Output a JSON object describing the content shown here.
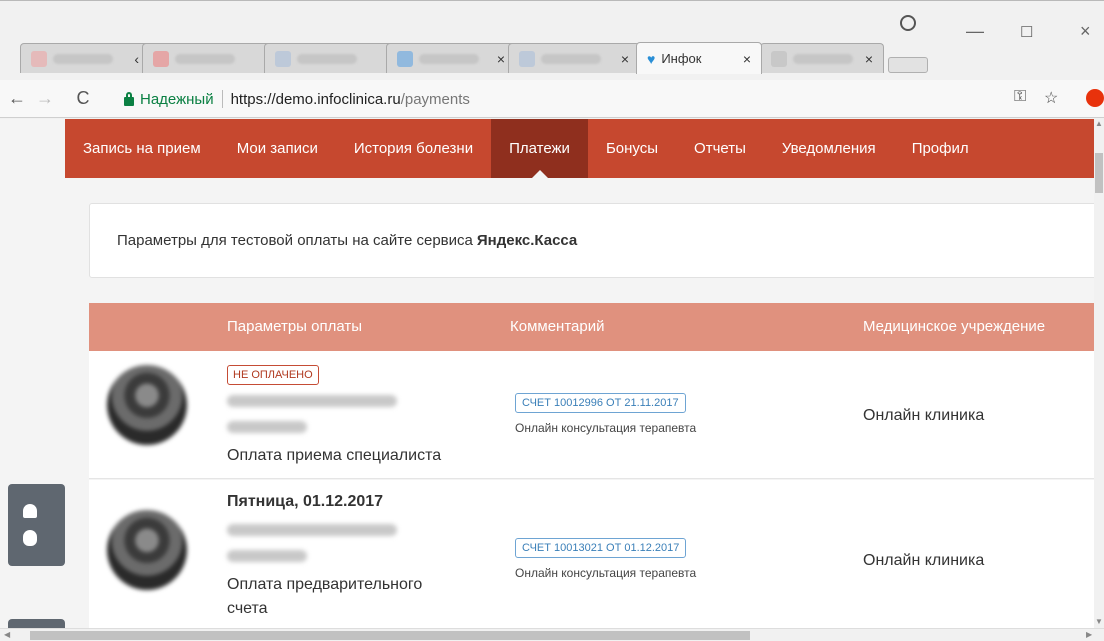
{
  "browser": {
    "tabs": [
      {
        "title": "",
        "close": "‹"
      },
      {
        "title": "",
        "close": ""
      },
      {
        "title": "",
        "close": ""
      },
      {
        "title": "",
        "close": "×"
      },
      {
        "title": "",
        "close": "×"
      },
      {
        "title": "Инфок",
        "close": "×"
      },
      {
        "title": "",
        "close": "×"
      }
    ],
    "window_controls": {
      "minimize": "—",
      "maximize": "☐",
      "close": "×"
    },
    "secure_label": "Надежный",
    "url_host": "https://demo.infoclinica.ru",
    "url_path": "/payments"
  },
  "navbar": {
    "items": [
      {
        "label": "Запись на прием",
        "active": false
      },
      {
        "label": "Мои записи",
        "active": false
      },
      {
        "label": "История болезни",
        "active": false
      },
      {
        "label": "Платежи",
        "active": true
      },
      {
        "label": "Бонусы",
        "active": false
      },
      {
        "label": "Отчеты",
        "active": false
      },
      {
        "label": "Уведомления",
        "active": false
      },
      {
        "label": "Профил",
        "active": false
      }
    ]
  },
  "info": {
    "text": "Параметры для тестовой оплаты на сайте сервиса",
    "service": "Яндекс.Касса"
  },
  "table": {
    "headers": [
      "Параметры оплаты",
      "Комментарий",
      "Медицинское учреждение"
    ],
    "rows": [
      {
        "status": "НЕ ОПЛАЧЕНО",
        "date": "",
        "payment_type_1": "Оплата приема специалиста",
        "payment_type_2": "",
        "invoice": "СЧЕТ 10012996 ОТ 21.11.2017",
        "comment": "Онлайн консультация терапевта",
        "clinic": "Онлайн клиника"
      },
      {
        "status": "",
        "date": "Пятница, 01.12.2017",
        "payment_type_1": "Оплата предварительного",
        "payment_type_2": "счета",
        "invoice": "СЧЕТ 10013021 ОТ 01.12.2017",
        "comment": "Онлайн консультация терапевта",
        "clinic": "Онлайн клиника"
      }
    ]
  },
  "colors": {
    "navbar": "#c6482f",
    "navbar_active": "#8f2f1e",
    "table_header": "#e0917e",
    "status_unpaid": "#b0391f",
    "invoice": "#3a7fb8",
    "secure": "#0b8043"
  }
}
